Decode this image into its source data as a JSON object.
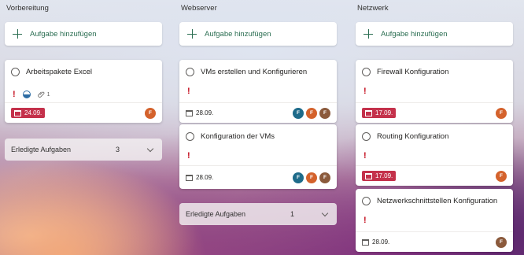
{
  "colors": {
    "accent_green": "#2b6e52",
    "overdue_red": "#c4314b",
    "avatar_teal": "#1e6b8a",
    "avatar_orange": "#d4622c",
    "avatar_brown": "#8b5a3c"
  },
  "add_task_label": "Aufgabe hinzufügen",
  "columns": [
    {
      "title": "Vorbereitung",
      "cards": [
        {
          "title": "Arbeitspakete Excel",
          "attachment_count": "1",
          "date": "24.09.",
          "avatars": [
            "F"
          ]
        }
      ],
      "completed": {
        "label": "Erledigte Aufgaben",
        "count": "3"
      }
    },
    {
      "title": "Webserver",
      "cards": [
        {
          "title": "VMs erstellen und Konfigurieren",
          "date": "28.09.",
          "avatars": [
            "F",
            "F",
            "F"
          ]
        },
        {
          "title": "Konfiguration der VMs",
          "date": "28.09.",
          "avatars": [
            "F",
            "F",
            "F"
          ]
        }
      ],
      "completed": {
        "label": "Erledigte Aufgaben",
        "count": "1"
      }
    },
    {
      "title": "Netzwerk",
      "cards": [
        {
          "title": "Firewall Konfiguration",
          "date": "17.09.",
          "avatars": [
            "F"
          ]
        },
        {
          "title": "Routing Konfiguration",
          "date": "17.09.",
          "avatars": [
            "F"
          ]
        },
        {
          "title": "Netzwerkschnittstellen Konfiguration",
          "date": "28.09.",
          "avatars": [
            "F"
          ]
        }
      ]
    }
  ],
  "priority_mark": "!"
}
